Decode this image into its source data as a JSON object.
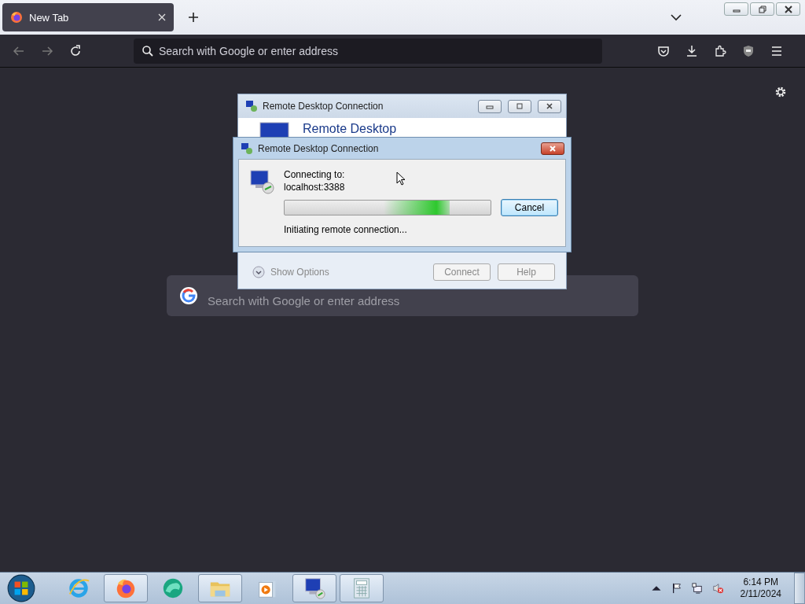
{
  "browser": {
    "tabs": [
      {
        "title": "New Tab",
        "selected": true
      }
    ],
    "address_bar": {
      "placeholder": "Search with Google or enter address"
    },
    "newtab_search": {
      "placeholder": "Search with Google or enter address"
    }
  },
  "back_dialog": {
    "title": "Remote Desktop Connection",
    "heading": "Remote Desktop",
    "show_options": "Show Options",
    "buttons": [
      {
        "label": "Connect",
        "disabled": true
      },
      {
        "label": "Help",
        "disabled": true
      }
    ]
  },
  "front_dialog": {
    "title": "Remote Desktop Connection",
    "connecting_label": "Connecting to:",
    "host": "localhost:3388",
    "status": "Initiating remote connection...",
    "progress": {
      "level": 0.8
    },
    "buttons": [
      {
        "label": "Cancel",
        "disabled": false
      }
    ]
  },
  "taskbar": {
    "apps": [
      {
        "kind": "ie",
        "running": false
      },
      {
        "kind": "firefox",
        "running": true
      },
      {
        "kind": "edge",
        "running": false
      },
      {
        "kind": "explorer",
        "running": true
      },
      {
        "kind": "media",
        "running": false
      },
      {
        "kind": "rdp",
        "running": true
      },
      {
        "kind": "calculator",
        "running": true
      }
    ],
    "clock": {
      "time": "6:14 PM",
      "date": "2/11/2024"
    }
  }
}
